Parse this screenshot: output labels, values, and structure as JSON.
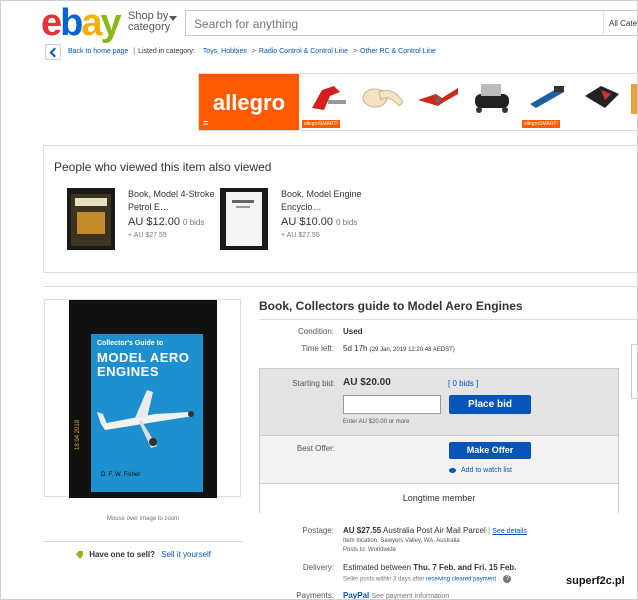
{
  "header": {
    "logo": [
      "e",
      "b",
      "a",
      "y"
    ],
    "shop_by_line1": "Shop by",
    "shop_by_line2": "category",
    "search_placeholder": "Search for anything",
    "all_categories": "All Cate"
  },
  "breadcrumb": {
    "back": "Back to home page",
    "listed": "Listed in category:",
    "items": [
      "Toys, Hobbies",
      "Radio Control & Control Line",
      "Other RC & Control Line"
    ]
  },
  "ad": {
    "brand": "allegro",
    "badge": "allegroSMART!",
    "brand_color": "#ff5a00"
  },
  "also_viewed": {
    "heading": "People who viewed this item also viewed",
    "items": [
      {
        "name": "Book, Model 4-Stroke Petrol E…",
        "price": "AU $12.00",
        "bids": "0 bids",
        "shipping": "+ AU $27.55"
      },
      {
        "name": "Book, Model Engine Encyclo…",
        "price": "AU $10.00",
        "bids": "0 bids",
        "shipping": "+ AU $27.55"
      }
    ]
  },
  "listing": {
    "title": "Book, Collectors guide to Model Aero Engines",
    "condition_label": "Condition:",
    "condition": "Used",
    "time_left_label": "Time left:",
    "time_left": "5d 17h",
    "time_left_detail": "(29 Jan, 2019  12:20:48 AEDST)",
    "starting_bid_label": "Starting bid:",
    "starting_bid": "AU $20.00",
    "bids_link": "[ 0 bids ]",
    "enter_hint": "Enter AU $20.00 or more",
    "place_bid": "Place bid",
    "best_offer_label": "Best Offer:",
    "make_offer": "Make Offer",
    "watch": "Add to watch list",
    "longtime": "Longtime member",
    "postage_label": "Postage:",
    "postage_price": "AU $27.55",
    "postage_service": "Australia Post Air Mail Parcel",
    "see_details": "See details",
    "item_location": "Item location:  Sawyers Valley, WA, Australia",
    "posts_to": "Posts to:  Worldwide",
    "delivery_label": "Delivery:",
    "delivery_pre": "Estimated between ",
    "delivery_dates": "Thu. 7 Feb. and Fri. 15 Feb.",
    "seller_posts": "Seller posts within 3 days after ",
    "cleared_payment": "receiving cleared payment",
    "payments_label": "Payments:",
    "payments_val": "PayPal",
    "payments_more": "See payment information"
  },
  "book_cover": {
    "title_line1": "Collector's Guide to",
    "title_line2": "MODEL AERO",
    "title_line3": "ENGINES",
    "author": "D. F. W. Fisher",
    "spine_text": "18 04 2018"
  },
  "gallery": {
    "zoom_hint": "Mouse over image to zoom"
  },
  "sell": {
    "question": "Have one to sell?",
    "link": "Sell it yourself"
  },
  "watermark": "superf2c.pl"
}
